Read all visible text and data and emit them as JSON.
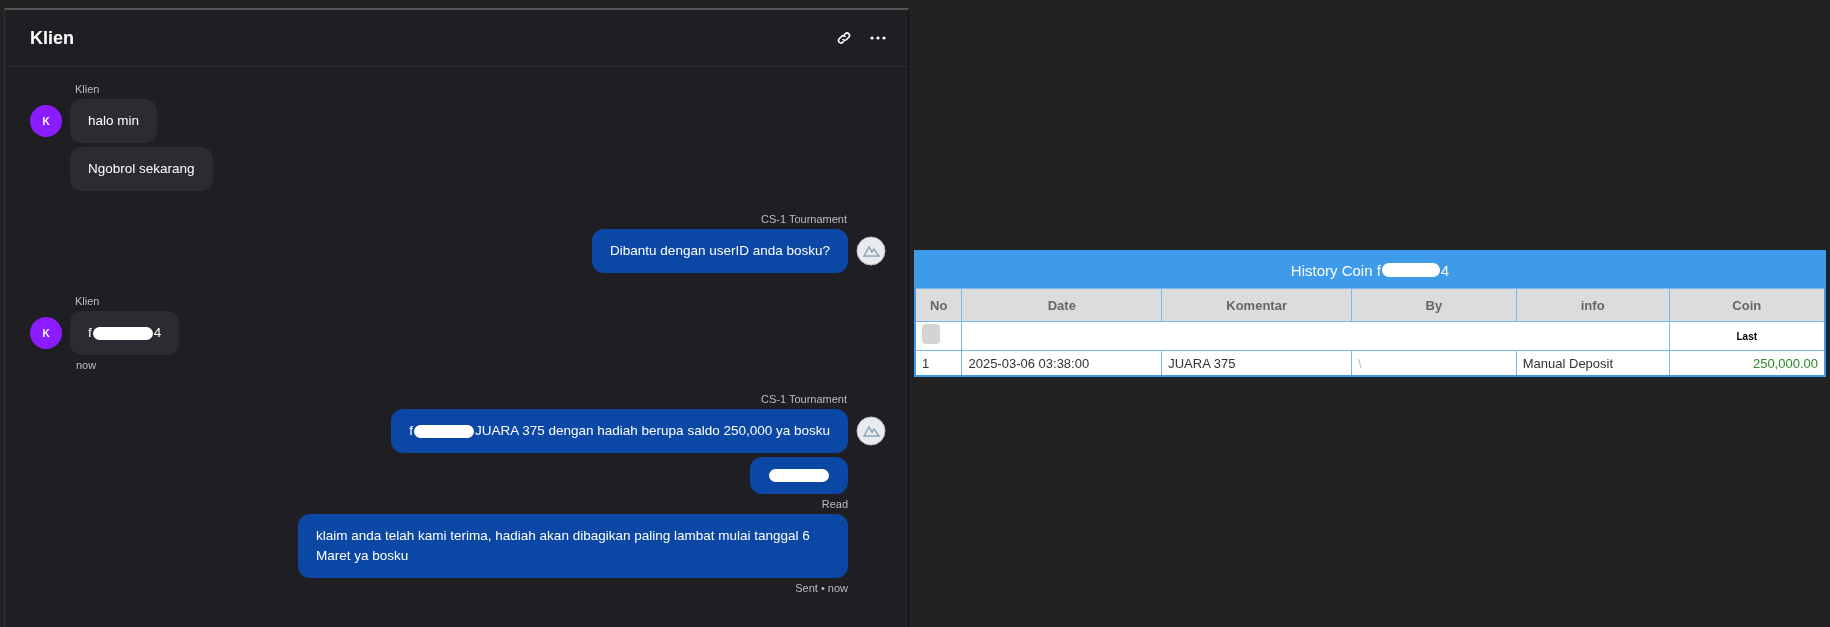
{
  "chat": {
    "title": "Klien",
    "groups": [
      {
        "kind": "incoming",
        "sender": "Klien",
        "avatar_letter": "K",
        "messages": [
          {
            "parts": [
              {
                "kind": "text",
                "text": "halo min"
              }
            ]
          },
          {
            "parts": [
              {
                "kind": "text",
                "text": "Ngobrol sekarang"
              }
            ]
          }
        ]
      },
      {
        "kind": "outgoing",
        "sender": "CS-1 Tournament",
        "messages": [
          {
            "parts": [
              {
                "kind": "text",
                "text": "Dibantu dengan userID anda bosku?"
              }
            ]
          }
        ]
      },
      {
        "kind": "incoming",
        "sender": "Klien",
        "avatar_letter": "K",
        "messages": [
          {
            "parts": [
              {
                "kind": "text",
                "text": "f"
              },
              {
                "kind": "redaction"
              },
              {
                "kind": "text",
                "text": "4"
              }
            ]
          }
        ],
        "footer": "now"
      },
      {
        "kind": "outgoing",
        "sender": "CS-1 Tournament",
        "messages": [
          {
            "parts": [
              {
                "kind": "text",
                "text": "f"
              },
              {
                "kind": "redaction"
              },
              {
                "kind": "text",
                "text": "JUARA 375 dengan hadiah berupa saldo 250,000 ya bosku"
              }
            ]
          },
          {
            "parts": [
              {
                "kind": "redaction"
              }
            ],
            "status": "Read"
          },
          {
            "parts": [
              {
                "kind": "text",
                "text": "klaim anda telah kami terima, hadiah akan dibagikan paling lambat mulai tanggal 6 Maret ya bosku"
              }
            ]
          }
        ],
        "footer": "Sent • now"
      }
    ]
  },
  "history": {
    "title_parts": [
      {
        "kind": "text",
        "text": "History Coin f"
      },
      {
        "kind": "redaction"
      },
      {
        "kind": "text",
        "text": "4"
      }
    ],
    "columns": [
      "No",
      "Date",
      "Komentar",
      "By",
      "info",
      "Coin"
    ],
    "summary_label": "Last",
    "rows": [
      {
        "cells": [
          "1",
          "2025-03-06 03:38:00",
          "JUARA 375",
          "\\",
          "Manual Deposit",
          "250,000.00"
        ]
      }
    ]
  }
}
